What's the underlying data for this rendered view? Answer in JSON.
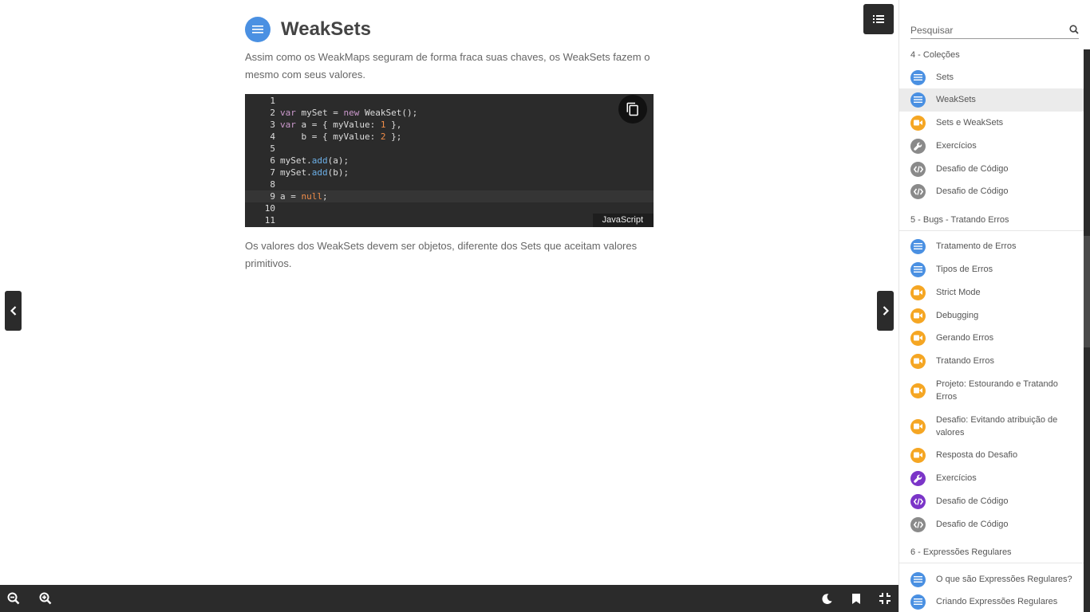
{
  "lesson": {
    "title": "WeakSets",
    "intro": "Assim como os WeakMaps seguram de forma fraca suas chaves, os WeakSets fazem o mesmo com seus valores.",
    "outro": "Os valores dos WeakSets devem ser objetos, diferente dos Sets que aceitam valores primitivos.",
    "icon": "list-icon"
  },
  "code": {
    "language": "JavaScript",
    "active_line": 9,
    "lines": [
      {
        "n": "1",
        "tokens": []
      },
      {
        "n": "2",
        "tokens": [
          [
            "kw",
            "var"
          ],
          [
            "t",
            " mySet = "
          ],
          [
            "kw",
            "new"
          ],
          [
            "t",
            " WeakSet();"
          ]
        ]
      },
      {
        "n": "3",
        "tokens": [
          [
            "kw",
            "var"
          ],
          [
            "t",
            " a = { myValue: "
          ],
          [
            "num",
            "1"
          ],
          [
            "t",
            " },"
          ]
        ]
      },
      {
        "n": "4",
        "tokens": [
          [
            "t",
            "    b = { myValue: "
          ],
          [
            "num",
            "2"
          ],
          [
            "t",
            " };"
          ]
        ]
      },
      {
        "n": "5",
        "tokens": []
      },
      {
        "n": "6",
        "tokens": [
          [
            "t",
            "mySet."
          ],
          [
            "fn",
            "add"
          ],
          [
            "t",
            "(a);"
          ]
        ]
      },
      {
        "n": "7",
        "tokens": [
          [
            "t",
            "mySet."
          ],
          [
            "fn",
            "add"
          ],
          [
            "t",
            "(b);"
          ]
        ]
      },
      {
        "n": "8",
        "tokens": []
      },
      {
        "n": "9",
        "tokens": [
          [
            "t",
            "a = "
          ],
          [
            "lit",
            "null"
          ],
          [
            "t",
            ";"
          ]
        ]
      },
      {
        "n": "10",
        "tokens": []
      },
      {
        "n": "11",
        "tokens": []
      }
    ]
  },
  "search": {
    "placeholder": "Pesquisar"
  },
  "sidebar": {
    "sections": [
      {
        "title": "4 - Coleções",
        "items": [
          {
            "label": "Sets",
            "icon": "text-icon",
            "color": "#4a90e2"
          },
          {
            "label": "WeakSets",
            "icon": "text-icon",
            "color": "#4a90e2",
            "selected": true
          },
          {
            "label": "Sets e WeakSets",
            "icon": "video-icon",
            "color": "#f5a623"
          },
          {
            "label": "Exercícios",
            "icon": "wrench-icon",
            "color": "#8a8a8a"
          },
          {
            "label": "Desafio de Código",
            "icon": "code-icon",
            "color": "#8a8a8a"
          },
          {
            "label": "Desafio de Código",
            "icon": "code-icon",
            "color": "#8a8a8a"
          }
        ]
      },
      {
        "title": "5 - Bugs - Tratando Erros",
        "items": [
          {
            "label": "Tratamento de Erros",
            "icon": "text-icon",
            "color": "#4a90e2"
          },
          {
            "label": "Tipos de Erros",
            "icon": "text-icon",
            "color": "#4a90e2"
          },
          {
            "label": "Strict Mode",
            "icon": "video-icon",
            "color": "#f5a623"
          },
          {
            "label": "Debugging",
            "icon": "video-icon",
            "color": "#f5a623"
          },
          {
            "label": "Gerando Erros",
            "icon": "video-icon",
            "color": "#f5a623"
          },
          {
            "label": "Tratando Erros",
            "icon": "video-icon",
            "color": "#f5a623"
          },
          {
            "label": "Projeto: Estourando e Tratando Erros",
            "icon": "video-icon",
            "color": "#f5a623"
          },
          {
            "label": "Desafio: Evitando atribuição de valores",
            "icon": "video-icon",
            "color": "#f5a623"
          },
          {
            "label": "Resposta do Desafio",
            "icon": "video-icon",
            "color": "#f5a623"
          },
          {
            "label": "Exercícios",
            "icon": "wrench-icon",
            "color": "#7b35c8"
          },
          {
            "label": "Desafio de Código",
            "icon": "code-icon",
            "color": "#7b35c8"
          },
          {
            "label": "Desafio de Código",
            "icon": "code-icon",
            "color": "#8a8a8a"
          }
        ]
      },
      {
        "title": "6 - Expressões Regulares",
        "items": [
          {
            "label": "O que são Expressões Regulares?",
            "icon": "text-icon",
            "color": "#4a90e2"
          },
          {
            "label": "Criando Expressões Regulares",
            "icon": "text-icon",
            "color": "#4a90e2"
          }
        ]
      }
    ]
  },
  "toolbar": {
    "buttons": [
      "zoom-out-icon",
      "zoom-in-icon",
      "moon-icon",
      "bookmark-icon",
      "collapse-icon"
    ]
  }
}
